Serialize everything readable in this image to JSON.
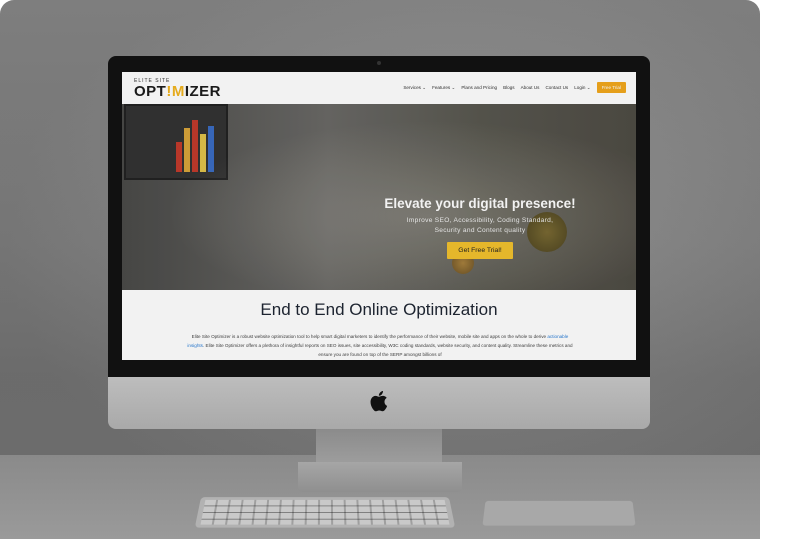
{
  "site": {
    "logo_small": "ELITE SITE",
    "logo_big_prefix": "OPT",
    "logo_big_mark": "!M",
    "logo_big_suffix": "IZER"
  },
  "nav": {
    "items": [
      "Services ⌄",
      "Features ⌄",
      "Plans and Pricing",
      "Blogs",
      "About Us",
      "Contact Us",
      "Login ⌄"
    ],
    "cta": "Free Trial"
  },
  "hero": {
    "title": "Elevate your digital presence!",
    "subtitle_line1": "Improve SEO, Accessibility, Coding Standard,",
    "subtitle_line2": "Security and Content quality",
    "button": "Get Free Trial!"
  },
  "content": {
    "title": "End to End Online Optimization",
    "body_part1": "Elite Site Optimizer is a robust website optimization tool to help smart digital marketers to identify the performance of their website, mobile site and apps on the whole to derive ",
    "body_link": "actionable insights",
    "body_part2": ". Elite Site Optimizer offers a plethora of insightful reports on SEO issues, site accessibility, W3C coding standards, website security, and content quality. Streamline these metrics and ensure you are found on top of the SERP amongst billions of"
  },
  "colors": {
    "accent": "#f2a81d",
    "hero_button": "#f2c12e",
    "link": "#2a7dd6"
  },
  "icons": {
    "apple_logo": "apple-icon"
  }
}
